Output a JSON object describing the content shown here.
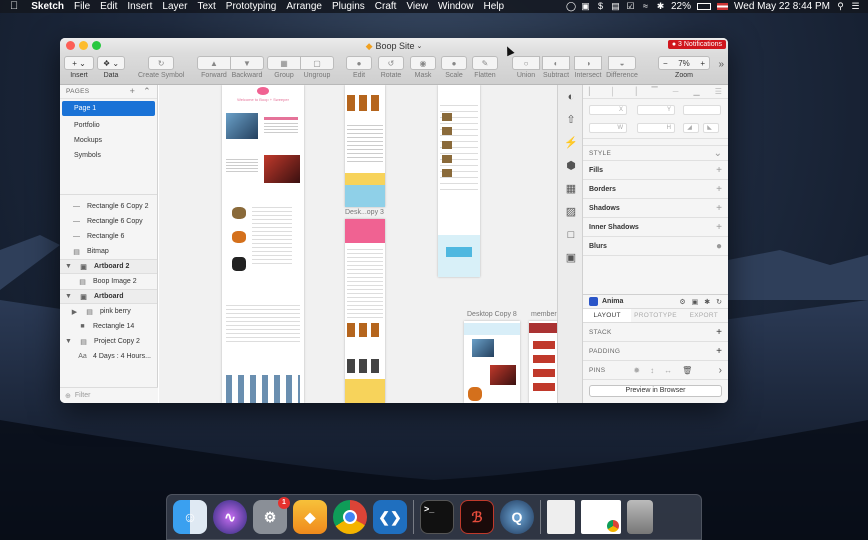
{
  "menubar": {
    "app_name": "Sketch",
    "menus": [
      "File",
      "Edit",
      "Insert",
      "Layer",
      "Text",
      "Prototyping",
      "Arrange",
      "Plugins",
      "Craft",
      "View",
      "Window",
      "Help"
    ],
    "battery": "22%",
    "clock": "Wed May 22  8:44 PM"
  },
  "window": {
    "title": "Boop Site",
    "notifications": "3 Notifications"
  },
  "toolbar": {
    "insert": "Insert",
    "data": "Data",
    "create_symbol": "Create Symbol",
    "forward": "Forward",
    "backward": "Backward",
    "group": "Group",
    "ungroup": "Ungroup",
    "edit": "Edit",
    "rotate": "Rotate",
    "mask": "Mask",
    "scale": "Scale",
    "flatten": "Flatten",
    "union": "Union",
    "subtract": "Subtract",
    "intersect": "Intersect",
    "difference": "Difference",
    "zoom_label": "Zoom",
    "zoom_value": "7%"
  },
  "pages": {
    "header": "PAGES",
    "items": [
      "Page 1",
      "Portfolio",
      "Mockups",
      "Symbols"
    ]
  },
  "layers": [
    {
      "label": "Rectangle 6 Copy 2",
      "kind": "line"
    },
    {
      "label": "Rectangle 6 Copy",
      "kind": "line"
    },
    {
      "label": "Rectangle 6",
      "kind": "line"
    },
    {
      "label": "Bitmap",
      "kind": "image"
    },
    {
      "label": "Artboard 2",
      "kind": "artboard"
    },
    {
      "label": "Boop Image 2",
      "kind": "image"
    },
    {
      "label": "Artboard",
      "kind": "artboard"
    },
    {
      "label": "pink berry",
      "kind": "group"
    },
    {
      "label": "Rectangle 14",
      "kind": "rect"
    },
    {
      "label": "Project Copy 2",
      "kind": "folder"
    },
    {
      "label": "4 Days : 4 Hours...",
      "kind": "text"
    }
  ],
  "filter_placeholder": "Filter",
  "canvas": {
    "artboard_labels": [
      "Desk...opy 3",
      "Desktop Copy 8",
      "member"
    ],
    "hero_title": "Welcome to Boop + Sweeper"
  },
  "inspector": {
    "style": "STYLE",
    "fills": "Fills",
    "borders": "Borders",
    "shadows": "Shadows",
    "inner_shadows": "Inner Shadows",
    "blurs": "Blurs",
    "fields": {
      "x": "X",
      "y": "Y",
      "w": "W",
      "h": "H"
    },
    "anima": "Anima",
    "tabs": [
      "LAYOUT",
      "PROTOTYPE",
      "EXPORT"
    ],
    "stack": "STACK",
    "padding": "PADDING",
    "pins": "PINS",
    "preview": "Preview in Browser"
  },
  "colors": {
    "selection": "#1a72d6",
    "notification": "#d0161d",
    "accent_pink": "#f06292",
    "accent_yellow": "#f7d35b"
  }
}
